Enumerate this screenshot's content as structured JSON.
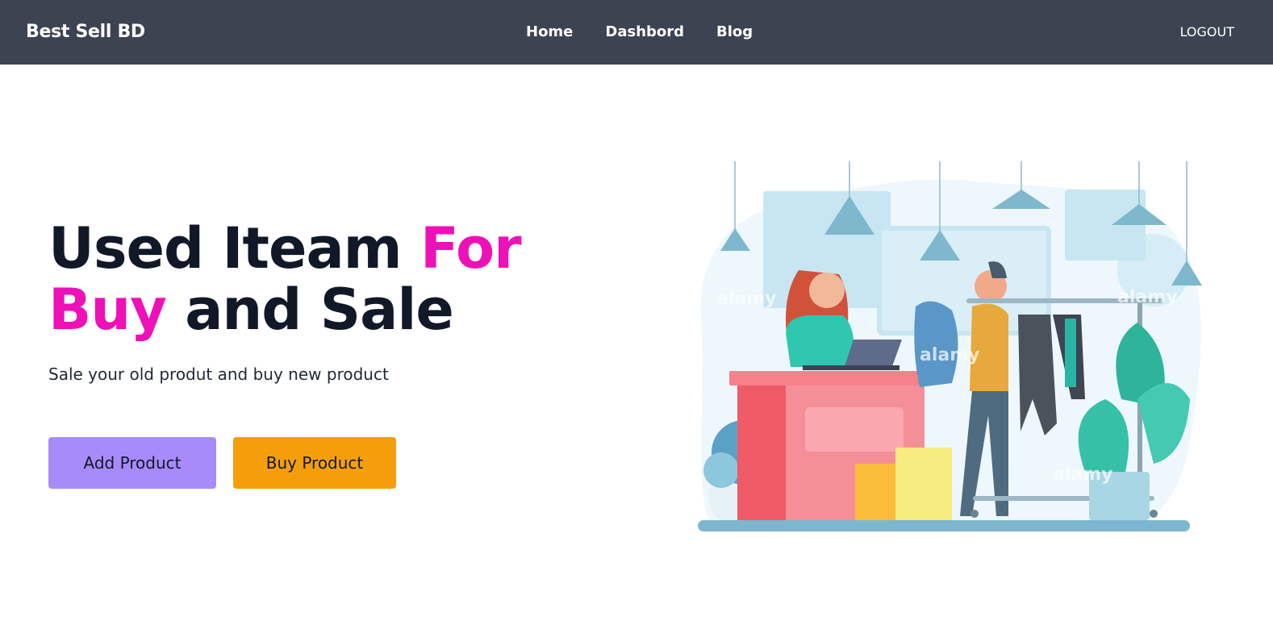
{
  "header": {
    "brand": "Best Sell BD",
    "nav": [
      {
        "label": "Home"
      },
      {
        "label": "Dashbord"
      },
      {
        "label": "Blog"
      }
    ],
    "logout_label": "LOGOUT"
  },
  "hero": {
    "title_part1": "Used Iteam ",
    "title_accent1": "For",
    "title_accent2": "Buy",
    "title_part2": " and Sale",
    "subtitle": "Sale your old produt and buy new product",
    "add_button": "Add Product",
    "buy_button": "Buy Product"
  },
  "illustration": {
    "watermark": "alamy"
  },
  "colors": {
    "navbar": "#3d4451",
    "accent": "#ee11b8",
    "add_button": "#a78bfa",
    "buy_button": "#f59e0b"
  }
}
